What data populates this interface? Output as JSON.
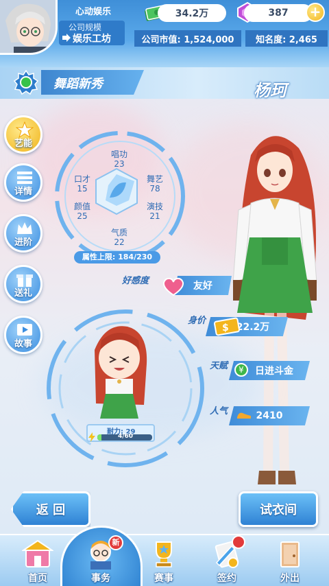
{
  "top": {
    "company_name": "心动娱乐",
    "scale_title": "公司规模",
    "scale_value": "娱乐工坊",
    "cash": "34.2万",
    "gems": "387",
    "plus": "+",
    "market_value": "公司市值: 1,524,000",
    "fame": "知名度: 2,465"
  },
  "header": {
    "category": "舞蹈新秀",
    "character_name": "杨珂"
  },
  "side_menu": [
    {
      "label": "艺能",
      "icon": "star-icon"
    },
    {
      "label": "详情",
      "icon": "list-icon"
    },
    {
      "label": "进阶",
      "icon": "crown-icon"
    },
    {
      "label": "送礼",
      "icon": "gift-icon"
    },
    {
      "label": "故事",
      "icon": "play-icon"
    }
  ],
  "attributes": {
    "singing": {
      "name": "唱功",
      "value": "23"
    },
    "dance": {
      "name": "舞艺",
      "value": "78"
    },
    "acting": {
      "name": "演技",
      "value": "21"
    },
    "temperament": {
      "name": "气质",
      "value": "22"
    },
    "looks": {
      "name": "颜值",
      "value": "25"
    },
    "eloquence": {
      "name": "口才",
      "value": "15"
    },
    "limit": "属性上限: 184/230"
  },
  "stats": {
    "affinity_label": "好感度",
    "affinity_value": "友好",
    "price_label": "身价",
    "price_value": "22.2万",
    "talent_label": "天赋",
    "talent_value": "日进斗金",
    "popularity_label": "人气",
    "popularity_value": "2410"
  },
  "stamina": {
    "label": "耐力: 29",
    "text": "4/60",
    "fill_fraction": 0.07
  },
  "buttons": {
    "back": "返 回",
    "dressing": "试衣间"
  },
  "bottom_nav": [
    {
      "label": "首页",
      "icon": "home-icon"
    },
    {
      "label": "事务",
      "icon": "affairs-icon",
      "badge": "新"
    },
    {
      "label": "赛事",
      "icon": "trophy-icon"
    },
    {
      "label": "签约",
      "icon": "contract-icon"
    },
    {
      "label": "外出",
      "icon": "door-icon"
    }
  ],
  "colors": {
    "primary_blue": "#3f8cd8",
    "gold": "#f0b41c",
    "badge_red": "#e23b3b"
  }
}
